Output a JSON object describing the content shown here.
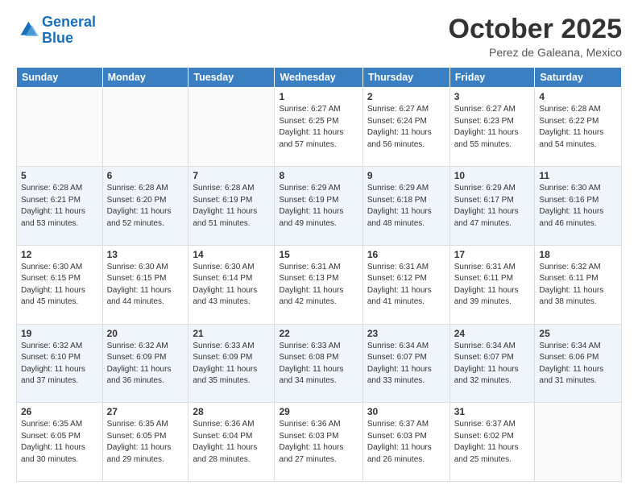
{
  "header": {
    "logo_line1": "General",
    "logo_line2": "Blue",
    "month": "October 2025",
    "location": "Perez de Galeana, Mexico"
  },
  "weekdays": [
    "Sunday",
    "Monday",
    "Tuesday",
    "Wednesday",
    "Thursday",
    "Friday",
    "Saturday"
  ],
  "weeks": [
    [
      {
        "day": "",
        "info": ""
      },
      {
        "day": "",
        "info": ""
      },
      {
        "day": "",
        "info": ""
      },
      {
        "day": "1",
        "info": "Sunrise: 6:27 AM\nSunset: 6:25 PM\nDaylight: 11 hours\nand 57 minutes."
      },
      {
        "day": "2",
        "info": "Sunrise: 6:27 AM\nSunset: 6:24 PM\nDaylight: 11 hours\nand 56 minutes."
      },
      {
        "day": "3",
        "info": "Sunrise: 6:27 AM\nSunset: 6:23 PM\nDaylight: 11 hours\nand 55 minutes."
      },
      {
        "day": "4",
        "info": "Sunrise: 6:28 AM\nSunset: 6:22 PM\nDaylight: 11 hours\nand 54 minutes."
      }
    ],
    [
      {
        "day": "5",
        "info": "Sunrise: 6:28 AM\nSunset: 6:21 PM\nDaylight: 11 hours\nand 53 minutes."
      },
      {
        "day": "6",
        "info": "Sunrise: 6:28 AM\nSunset: 6:20 PM\nDaylight: 11 hours\nand 52 minutes."
      },
      {
        "day": "7",
        "info": "Sunrise: 6:28 AM\nSunset: 6:19 PM\nDaylight: 11 hours\nand 51 minutes."
      },
      {
        "day": "8",
        "info": "Sunrise: 6:29 AM\nSunset: 6:19 PM\nDaylight: 11 hours\nand 49 minutes."
      },
      {
        "day": "9",
        "info": "Sunrise: 6:29 AM\nSunset: 6:18 PM\nDaylight: 11 hours\nand 48 minutes."
      },
      {
        "day": "10",
        "info": "Sunrise: 6:29 AM\nSunset: 6:17 PM\nDaylight: 11 hours\nand 47 minutes."
      },
      {
        "day": "11",
        "info": "Sunrise: 6:30 AM\nSunset: 6:16 PM\nDaylight: 11 hours\nand 46 minutes."
      }
    ],
    [
      {
        "day": "12",
        "info": "Sunrise: 6:30 AM\nSunset: 6:15 PM\nDaylight: 11 hours\nand 45 minutes."
      },
      {
        "day": "13",
        "info": "Sunrise: 6:30 AM\nSunset: 6:15 PM\nDaylight: 11 hours\nand 44 minutes."
      },
      {
        "day": "14",
        "info": "Sunrise: 6:30 AM\nSunset: 6:14 PM\nDaylight: 11 hours\nand 43 minutes."
      },
      {
        "day": "15",
        "info": "Sunrise: 6:31 AM\nSunset: 6:13 PM\nDaylight: 11 hours\nand 42 minutes."
      },
      {
        "day": "16",
        "info": "Sunrise: 6:31 AM\nSunset: 6:12 PM\nDaylight: 11 hours\nand 41 minutes."
      },
      {
        "day": "17",
        "info": "Sunrise: 6:31 AM\nSunset: 6:11 PM\nDaylight: 11 hours\nand 39 minutes."
      },
      {
        "day": "18",
        "info": "Sunrise: 6:32 AM\nSunset: 6:11 PM\nDaylight: 11 hours\nand 38 minutes."
      }
    ],
    [
      {
        "day": "19",
        "info": "Sunrise: 6:32 AM\nSunset: 6:10 PM\nDaylight: 11 hours\nand 37 minutes."
      },
      {
        "day": "20",
        "info": "Sunrise: 6:32 AM\nSunset: 6:09 PM\nDaylight: 11 hours\nand 36 minutes."
      },
      {
        "day": "21",
        "info": "Sunrise: 6:33 AM\nSunset: 6:09 PM\nDaylight: 11 hours\nand 35 minutes."
      },
      {
        "day": "22",
        "info": "Sunrise: 6:33 AM\nSunset: 6:08 PM\nDaylight: 11 hours\nand 34 minutes."
      },
      {
        "day": "23",
        "info": "Sunrise: 6:34 AM\nSunset: 6:07 PM\nDaylight: 11 hours\nand 33 minutes."
      },
      {
        "day": "24",
        "info": "Sunrise: 6:34 AM\nSunset: 6:07 PM\nDaylight: 11 hours\nand 32 minutes."
      },
      {
        "day": "25",
        "info": "Sunrise: 6:34 AM\nSunset: 6:06 PM\nDaylight: 11 hours\nand 31 minutes."
      }
    ],
    [
      {
        "day": "26",
        "info": "Sunrise: 6:35 AM\nSunset: 6:05 PM\nDaylight: 11 hours\nand 30 minutes."
      },
      {
        "day": "27",
        "info": "Sunrise: 6:35 AM\nSunset: 6:05 PM\nDaylight: 11 hours\nand 29 minutes."
      },
      {
        "day": "28",
        "info": "Sunrise: 6:36 AM\nSunset: 6:04 PM\nDaylight: 11 hours\nand 28 minutes."
      },
      {
        "day": "29",
        "info": "Sunrise: 6:36 AM\nSunset: 6:03 PM\nDaylight: 11 hours\nand 27 minutes."
      },
      {
        "day": "30",
        "info": "Sunrise: 6:37 AM\nSunset: 6:03 PM\nDaylight: 11 hours\nand 26 minutes."
      },
      {
        "day": "31",
        "info": "Sunrise: 6:37 AM\nSunset: 6:02 PM\nDaylight: 11 hours\nand 25 minutes."
      },
      {
        "day": "",
        "info": ""
      }
    ]
  ]
}
